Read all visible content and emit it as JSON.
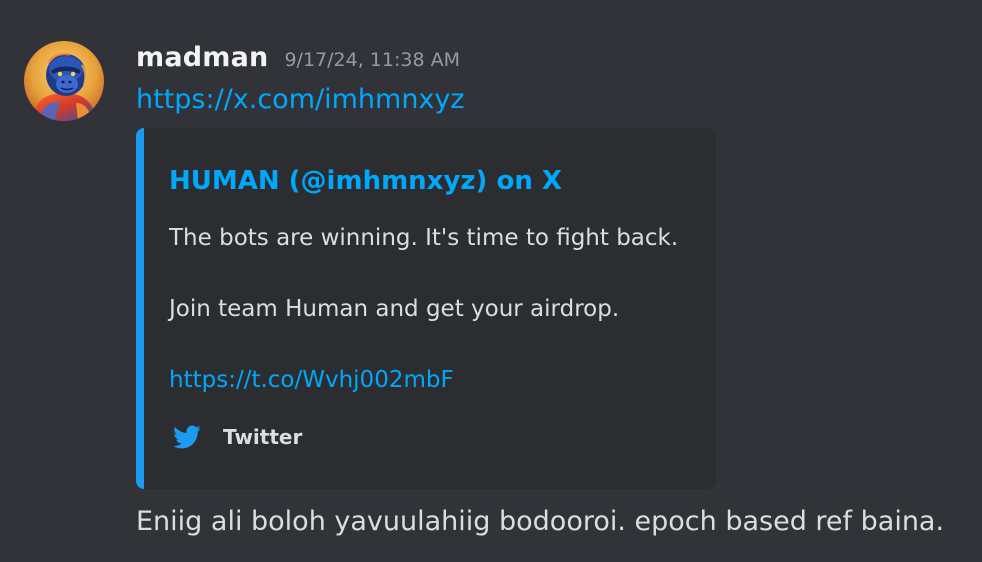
{
  "message": {
    "author": "madman",
    "timestamp": "9/17/24, 11:38 AM",
    "link": "https://x.com/imhmnxyz",
    "text": "Eniig ali boloh yavuulahiig bodooroi. epoch based ref baina."
  },
  "embed": {
    "accent_color": "#1d9bf0",
    "title": "HUMAN (@imhmnxyz) on X",
    "description_line1": "The bots are winning. It's time to fight back.",
    "description_line2": "Join team Human and get your airdrop.",
    "short_url": "https://t.co/Wvhj002mbF",
    "footer_icon": "twitter-bird-icon",
    "footer_text": "Twitter"
  },
  "colors": {
    "background": "#313338",
    "link": "#00a8fc",
    "embed_background": "#2b2d31",
    "username": "#f2f3f5",
    "timestamp": "#949ba4"
  }
}
